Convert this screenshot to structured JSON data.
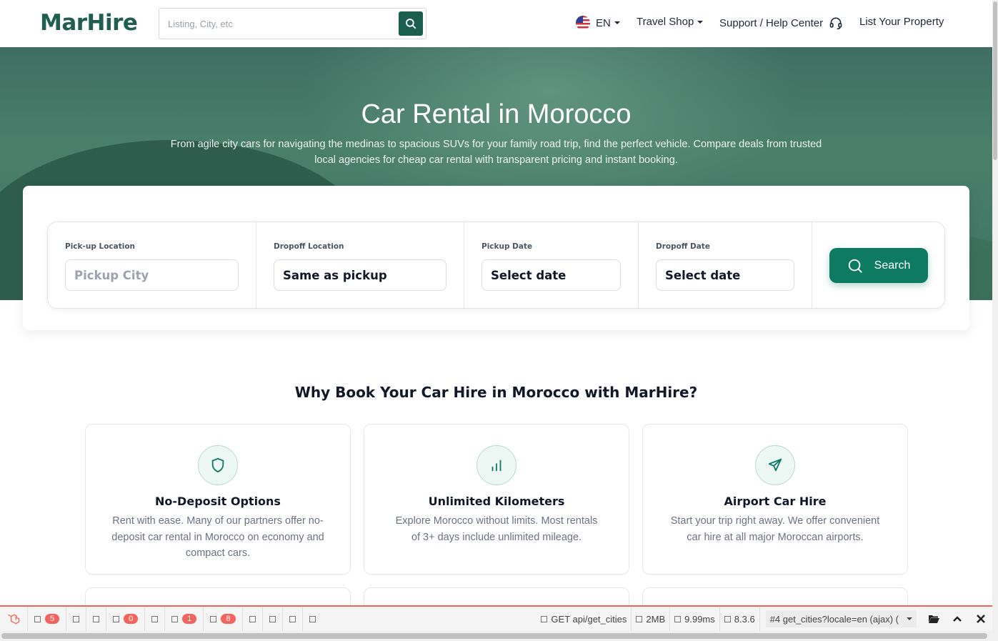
{
  "header": {
    "logo_text": "MarHire",
    "search_placeholder": "Listing, City, etc",
    "lang": "EN",
    "nav": [
      "Travel Shop",
      "Support / Help Center",
      "List Your Property"
    ]
  },
  "hero": {
    "title": "Car Rental in Morocco",
    "subtitle": "From agile city cars for navigating the medinas to spacious SUVs for your family road trip, find the perfect vehicle. Compare deals from trusted local agencies for cheap car rental with transparent pricing and instant booking."
  },
  "form": {
    "pickup_label": "Pick-up Location",
    "pickup_placeholder": "Pickup City",
    "dropoff_label": "Dropoff Location",
    "dropoff_value": "Same as pickup",
    "pickup_date_label": "Pickup Date",
    "pickup_date_value": "Select date",
    "dropoff_date_label": "Dropoff Date",
    "dropoff_date_value": "Select date",
    "search_label": "Search"
  },
  "why": {
    "title": "Why Book Your Car Hire in Morocco with MarHire?",
    "features": [
      {
        "icon": "shield-icon",
        "title": "No-Deposit Options",
        "text": "Rent with ease. Many of our partners offer no-deposit car rental in Morocco on economy and compact cars."
      },
      {
        "icon": "bar-chart-icon",
        "title": "Unlimited Kilometers",
        "text": "Explore Morocco without limits. Most rentals of 3+ days include unlimited mileage."
      },
      {
        "icon": "plane-icon",
        "title": "Airport Car Hire",
        "text": "Start your trip right away. We offer convenient car hire at all major Moroccan airports."
      }
    ]
  },
  "debugbar": {
    "badges": [
      "5",
      "0",
      "1",
      "8"
    ],
    "request": "GET api/get_cities",
    "memory": "2MB",
    "time": "9.99ms",
    "php_version": "8.3.6",
    "select": "#4 get_cities?locale=en (ajax) ("
  },
  "colors": {
    "brand": "#1b5e50",
    "cta": "#0f7a62",
    "debug_accent": "#f4645f"
  }
}
